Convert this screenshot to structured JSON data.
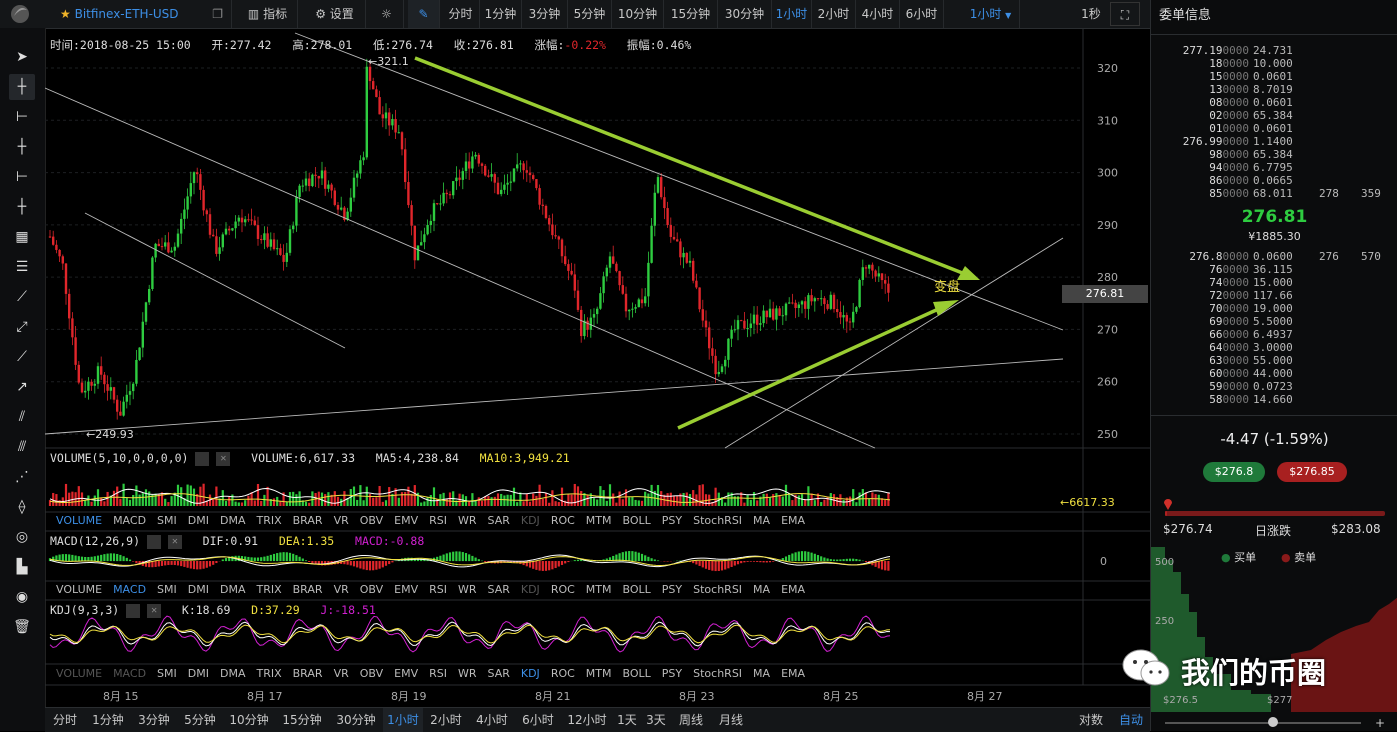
{
  "toolbar": {
    "symbol": "Bitfinex-ETH-USD",
    "indicators_label": "指标",
    "settings_label": "设置",
    "intervals": [
      "分时",
      "1分钟",
      "3分钟",
      "5分钟",
      "10分钟",
      "15分钟",
      "30分钟",
      "1小时",
      "2小时",
      "4小时",
      "6小时"
    ],
    "active_interval": "1小时",
    "dropdown_label": "1小时",
    "refresh_label": "1秒"
  },
  "info": {
    "time": "时间:2018-08-25 15:00",
    "open": "开:277.42",
    "high": "高:278.01",
    "low": "低:276.74",
    "close": "收:276.81",
    "change_label": "涨幅:",
    "change_value": "-0.22%",
    "amplitude": "振幅:0.46%"
  },
  "annotations": {
    "high_marker": "←321.1",
    "low_marker": "←249.93",
    "turning_label": "变盘",
    "last_price_tag": "276.81",
    "volume_marker": "←6617.33"
  },
  "price_axis": [
    "320",
    "310",
    "300",
    "290",
    "280",
    "270",
    "260",
    "250"
  ],
  "volume": {
    "header": "VOLUME(5,10,0,0,0,0)",
    "value": "VOLUME:6,617.33",
    "ma5": "MA5:4,238.84",
    "ma10": "MA10:3,949.21"
  },
  "indicator_tabs": [
    "VOLUME",
    "MACD",
    "SMI",
    "DMI",
    "DMA",
    "TRIX",
    "BRAR",
    "VR",
    "OBV",
    "EMV",
    "RSI",
    "WR",
    "SAR",
    "KDJ",
    "ROC",
    "MTM",
    "BOLL",
    "PSY",
    "StochRSI",
    "MA",
    "EMA"
  ],
  "macd": {
    "header": "MACD(12,26,9)",
    "dif": "DIF:0.91",
    "dea": "DEA:1.35",
    "macd": "MACD:-0.88",
    "zero_label": "0"
  },
  "kdj": {
    "header": "KDJ(9,3,3)",
    "k": "K:18.69",
    "d": "D:37.29",
    "j": "J:-18.51"
  },
  "date_axis": [
    "8月 15",
    "8月 17",
    "8月 19",
    "8月 21",
    "8月 23",
    "8月 25",
    "8月 27"
  ],
  "bottom_intervals": [
    "分时",
    "1分钟",
    "3分钟",
    "5分钟",
    "10分钟",
    "15分钟",
    "30分钟",
    "1小时",
    "2小时",
    "4小时",
    "6小时",
    "12小时",
    "1天",
    "3天",
    "周线",
    "月线"
  ],
  "bottom_right": [
    "对数",
    "自动"
  ],
  "orderbook": {
    "title": "委单信息",
    "asks": [
      {
        "price": "277.19",
        "zeros": "0000",
        "amount": "24.731",
        "c1": "",
        "c2": ""
      },
      {
        "price": "18",
        "zeros": "0000",
        "amount": "10.000",
        "c1": "",
        "c2": ""
      },
      {
        "price": "15",
        "zeros": "0000",
        "amount": "0.0601",
        "c1": "",
        "c2": ""
      },
      {
        "price": "13",
        "zeros": "0000",
        "amount": "8.7019",
        "c1": "",
        "c2": ""
      },
      {
        "price": "08",
        "zeros": "0000",
        "amount": "0.0601",
        "c1": "",
        "c2": ""
      },
      {
        "price": "02",
        "zeros": "0000",
        "amount": "65.384",
        "c1": "",
        "c2": ""
      },
      {
        "price": "01",
        "zeros": "0000",
        "amount": "0.0601",
        "c1": "",
        "c2": ""
      },
      {
        "price": "276.99",
        "zeros": "0000",
        "amount": "1.1400",
        "c1": "",
        "c2": ""
      },
      {
        "price": "98",
        "zeros": "0000",
        "amount": "65.384",
        "c1": "",
        "c2": ""
      },
      {
        "price": "94",
        "zeros": "0000",
        "amount": "6.7795",
        "c1": "",
        "c2": ""
      },
      {
        "price": "86",
        "zeros": "0000",
        "amount": "0.0665",
        "c1": "",
        "c2": ""
      },
      {
        "price": "85",
        "zeros": "0000",
        "amount": "68.011",
        "c1": "278",
        "c2": "359"
      }
    ],
    "last_price": "276.81",
    "last_cny": "¥1885.30",
    "bids": [
      {
        "price": "276.8",
        "zeros": "0000",
        "amount": "0.0600",
        "c1": "276",
        "c2": "570"
      },
      {
        "price": "76",
        "zeros": "0000",
        "amount": "36.115",
        "c1": "",
        "c2": ""
      },
      {
        "price": "74",
        "zeros": "0000",
        "amount": "15.000",
        "c1": "",
        "c2": ""
      },
      {
        "price": "72",
        "zeros": "0000",
        "amount": "117.66",
        "c1": "",
        "c2": ""
      },
      {
        "price": "70",
        "zeros": "0000",
        "amount": "19.000",
        "c1": "",
        "c2": ""
      },
      {
        "price": "69",
        "zeros": "0000",
        "amount": "5.5000",
        "c1": "",
        "c2": ""
      },
      {
        "price": "66",
        "zeros": "0000",
        "amount": "6.4937",
        "c1": "",
        "c2": ""
      },
      {
        "price": "64",
        "zeros": "0000",
        "amount": "3.0000",
        "c1": "",
        "c2": ""
      },
      {
        "price": "63",
        "zeros": "0000",
        "amount": "55.000",
        "c1": "",
        "c2": ""
      },
      {
        "price": "60",
        "zeros": "0000",
        "amount": "44.000",
        "c1": "",
        "c2": ""
      },
      {
        "price": "59",
        "zeros": "0000",
        "amount": "0.0723",
        "c1": "",
        "c2": ""
      },
      {
        "price": "58",
        "zeros": "0000",
        "amount": "14.660",
        "c1": "",
        "c2": ""
      }
    ],
    "change": "-4.47 (-1.59%)",
    "bid_pill": "$276.8",
    "ask_pill": "$276.85",
    "range_low": "$276.74",
    "range_label": "日涨跌",
    "range_high": "$283.08",
    "range_position": 0.01,
    "depth_buy_label": "买单",
    "depth_sell_label": "卖单",
    "depth_y": [
      "500",
      "250"
    ],
    "depth_x": [
      "$276.5",
      "$277"
    ],
    "watermark": "我们的币圈"
  },
  "colors": {
    "up": "#2ecc40",
    "down": "#e0262b",
    "accent": "#3d8fe6",
    "arrow": "#9acd32",
    "ma_yellow": "#f0e040"
  }
}
